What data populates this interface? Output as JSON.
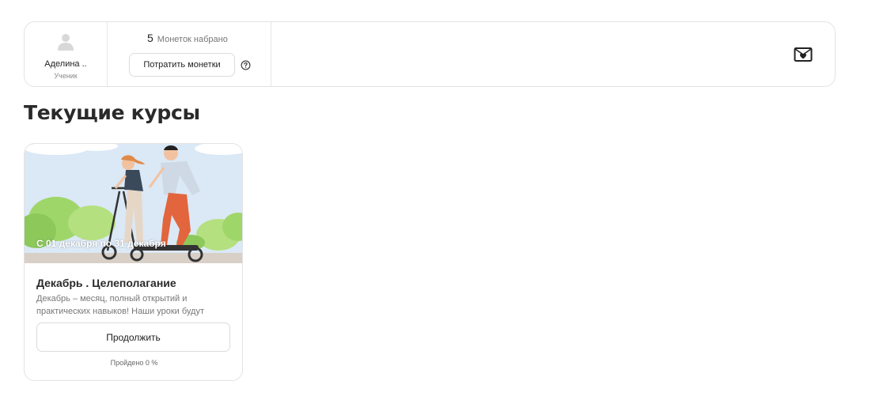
{
  "profile": {
    "name": "Аделина ..",
    "role": "Ученик",
    "avatar_icon": "user-silhouette-icon"
  },
  "coins": {
    "count": "5",
    "label": "Монеток набрано",
    "spend_label": "Потратить монетки",
    "help_icon": "question-circle-icon"
  },
  "header": {
    "mail_icon": "envelope-heart-icon"
  },
  "section": {
    "title": "Текущие курсы"
  },
  "course": {
    "dates": "С 01 декабря по 31 декабря",
    "title": "Декабрь . Целеполагание",
    "description": "Декабрь – месяц, полный открытий и практических навыков! Наши уроки будут",
    "continue_label": "Продолжить",
    "progress": "Пройдено 0 %"
  },
  "colors": {
    "sky": "#dbe8f5",
    "grass": "#9fd66a",
    "border": "#e3e3e3"
  }
}
